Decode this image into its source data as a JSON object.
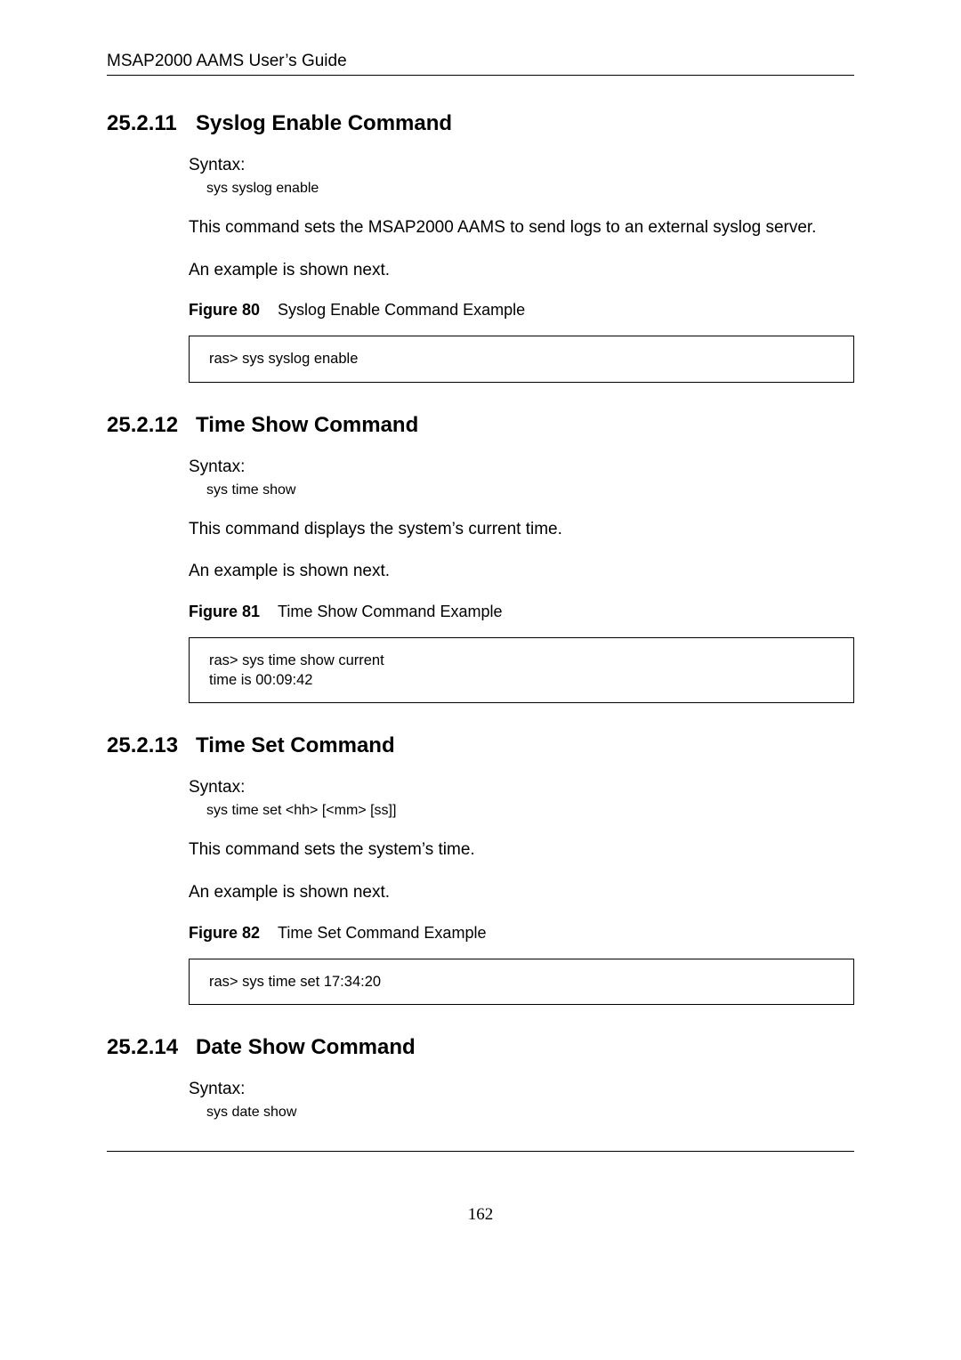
{
  "header": {
    "running": "MSAP2000 AAMS User’s Guide"
  },
  "sections": [
    {
      "num": "25.2.11",
      "title": "Syslog Enable Command",
      "syntaxLabel": "Syntax:",
      "syntaxCode": "sys syslog enable",
      "desc": "This command sets the MSAP2000 AAMS to send logs to an external syslog server.",
      "exampleIntro": "An example is shown next.",
      "figureLabel": "Figure 80",
      "figureTitle": "Syslog Enable Command Example",
      "codeBox": "ras> sys syslog enable"
    },
    {
      "num": "25.2.12",
      "title": "Time Show Command",
      "syntaxLabel": "Syntax:",
      "syntaxCode": "sys time show",
      "desc": "This command displays the system’s current time.",
      "exampleIntro": "An example is shown next.",
      "figureLabel": "Figure 81",
      "figureTitle": "Time Show Command Example",
      "codeBox": "ras> sys time show current\ntime is 00:09:42"
    },
    {
      "num": "25.2.13",
      "title": "Time Set Command",
      "syntaxLabel": "Syntax:",
      "syntaxCode": "sys time set <hh> [<mm> [ss]]",
      "desc": "This command sets the system’s time.",
      "exampleIntro": "An example is shown next.",
      "figureLabel": "Figure 82",
      "figureTitle": "Time Set Command Example",
      "codeBox": "ras> sys time set 17:34:20"
    },
    {
      "num": "25.2.14",
      "title": "Date Show Command",
      "syntaxLabel": "Syntax:",
      "syntaxCode": "sys date show"
    }
  ],
  "pageNumber": "162"
}
